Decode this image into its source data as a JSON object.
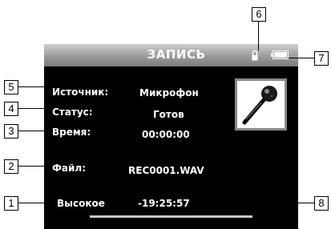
{
  "screen": {
    "title": "ЗАПИСЬ",
    "source_label": "Источник:",
    "source_value": "Микрофон",
    "status_label": "Статус:",
    "status_value": "Готов",
    "time_label": "Время:",
    "time_value": "00:00:00",
    "file_label": "Файл:",
    "file_value": "REC0001.WAV",
    "quality_value": "Высокое",
    "remaining_value": "-19:25:57",
    "icons": [
      "lock-icon",
      "battery-icon",
      "microphone-icon"
    ],
    "progress_fraction": 0
  },
  "callouts": [
    "1",
    "2",
    "3",
    "4",
    "5",
    "6",
    "7",
    "8"
  ]
}
